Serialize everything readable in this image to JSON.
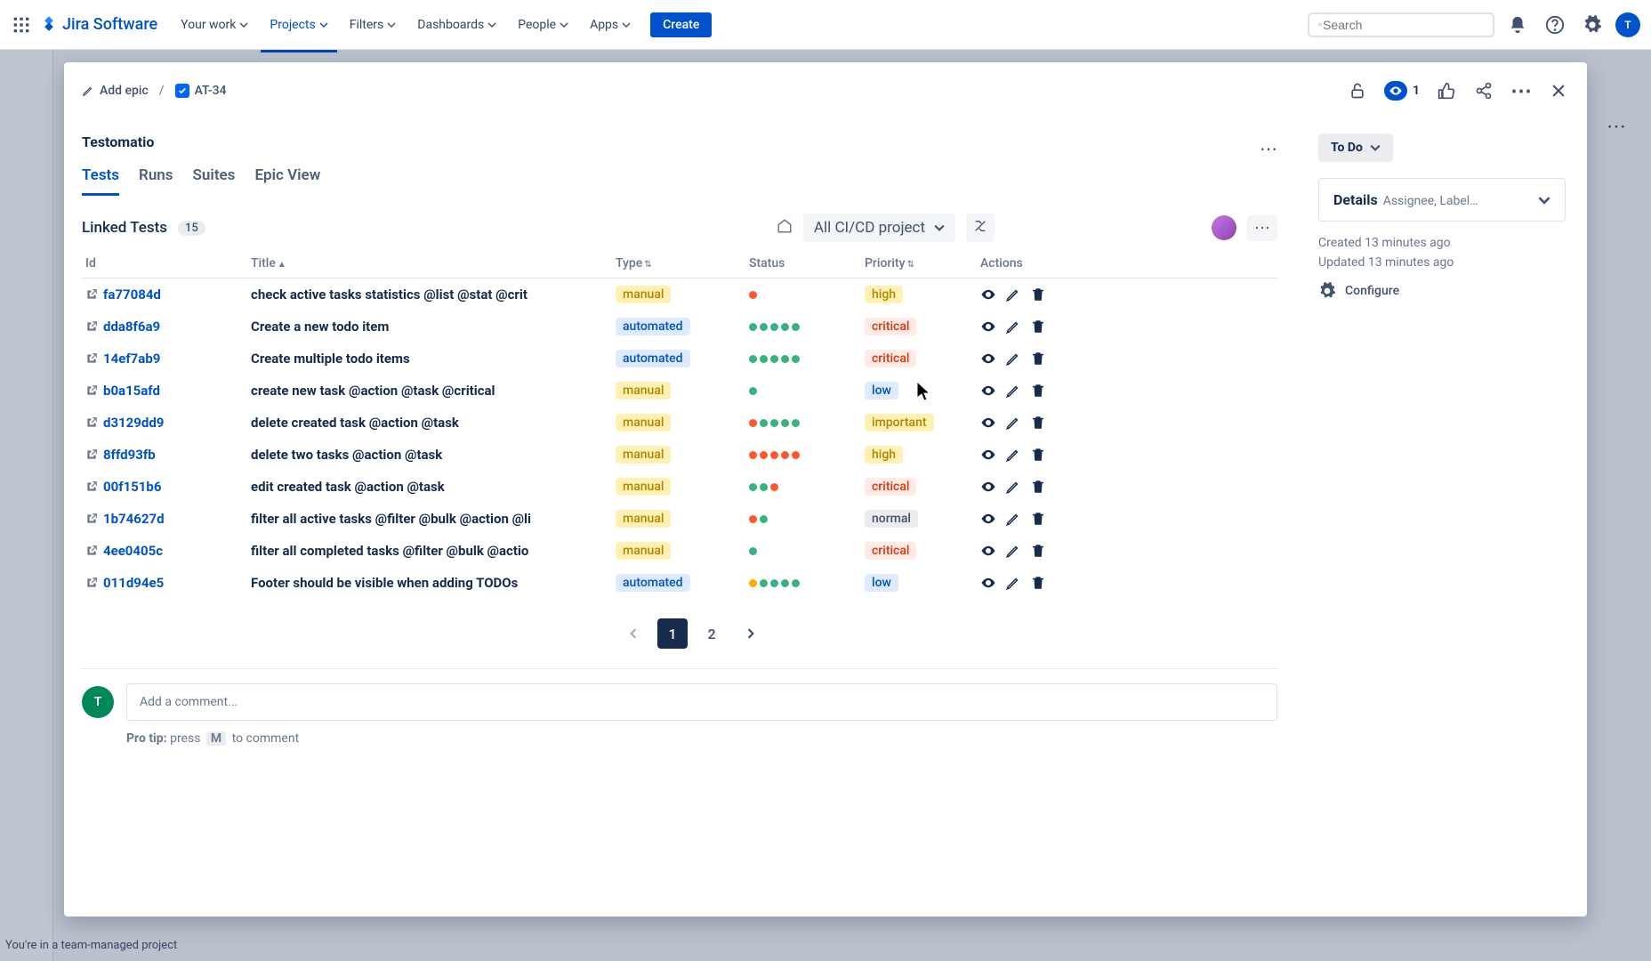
{
  "topnav": {
    "product": "Jira Software",
    "items": [
      "Your work",
      "Projects",
      "Filters",
      "Dashboards",
      "People",
      "Apps"
    ],
    "active_index": 1,
    "create_label": "Create",
    "search_placeholder": "Search"
  },
  "modal": {
    "breadcrumb": {
      "add_epic": "Add epic",
      "issue_key": "AT-34"
    },
    "topbar": {
      "watch_count": "1"
    },
    "panel": {
      "title": "Testomatio",
      "tabs": [
        "Tests",
        "Runs",
        "Suites",
        "Epic View"
      ],
      "active_tab": 0,
      "linked_label": "Linked Tests",
      "linked_count": "15",
      "project_dd": "All CI/CD project",
      "columns": {
        "id": "Id",
        "title": "Title",
        "type": "Type",
        "status": "Status",
        "priority": "Priority",
        "actions": "Actions"
      },
      "rows": [
        {
          "id": "fa77084d",
          "title": "check active tasks statistics @list @stat @crit",
          "type": "manual",
          "status": [
            "r"
          ],
          "priority": "high"
        },
        {
          "id": "dda8f6a9",
          "title": "Create a new todo item",
          "type": "automated",
          "status": [
            "g",
            "g",
            "g",
            "g",
            "g"
          ],
          "priority": "critical"
        },
        {
          "id": "14ef7ab9",
          "title": "Create multiple todo items",
          "type": "automated",
          "status": [
            "g",
            "g",
            "g",
            "g",
            "g"
          ],
          "priority": "critical"
        },
        {
          "id": "b0a15afd",
          "title": "create new task @action @task @critical",
          "type": "manual",
          "status": [
            "g"
          ],
          "priority": "low"
        },
        {
          "id": "d3129dd9",
          "title": "delete created task @action @task",
          "type": "manual",
          "status": [
            "r",
            "g",
            "g",
            "g",
            "g"
          ],
          "priority": "important"
        },
        {
          "id": "8ffd93fb",
          "title": "delete two tasks @action @task",
          "type": "manual",
          "status": [
            "r",
            "r",
            "r",
            "r",
            "r"
          ],
          "priority": "high"
        },
        {
          "id": "00f151b6",
          "title": "edit created task @action @task",
          "type": "manual",
          "status": [
            "g",
            "g",
            "r"
          ],
          "priority": "critical"
        },
        {
          "id": "1b74627d",
          "title": "filter all active tasks @filter @bulk @action @li",
          "type": "manual",
          "status": [
            "r",
            "g"
          ],
          "priority": "normal"
        },
        {
          "id": "4ee0405c",
          "title": "filter all completed tasks @filter @bulk @actio",
          "type": "manual",
          "status": [
            "g"
          ],
          "priority": "critical"
        },
        {
          "id": "011d94e5",
          "title": "Footer should be visible when adding TODOs",
          "type": "automated",
          "status": [
            "o",
            "g",
            "g",
            "g",
            "g"
          ],
          "priority": "low"
        }
      ],
      "pagination": {
        "pages": [
          "1",
          "2"
        ],
        "active": 0
      }
    },
    "comment": {
      "avatar_initial": "T",
      "placeholder": "Add a comment...",
      "protip_prefix": "Pro tip:",
      "protip_press": "press",
      "protip_key": "M",
      "protip_suffix": "to comment"
    },
    "side": {
      "status": "To Do",
      "details_label": "Details",
      "details_sub": "Assignee, Labels, ...",
      "created": "Created 13 minutes ago",
      "updated": "Updated 13 minutes ago",
      "configure": "Configure"
    }
  },
  "footer": "You're in a team-managed project"
}
